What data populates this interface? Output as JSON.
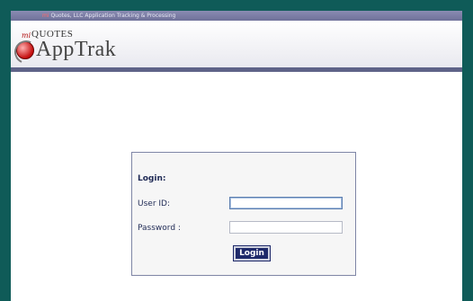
{
  "topbar": {
    "brand": "mi",
    "title": "Quotes, LLC Application Tracking & Processing"
  },
  "logo": {
    "mi": "mi",
    "quotes": "QUOTES",
    "app": "AppTrak"
  },
  "login": {
    "title": "Login:",
    "user_label": "User ID:",
    "password_label": "Password :",
    "button": "Login",
    "user_value": "",
    "password_value": ""
  }
}
